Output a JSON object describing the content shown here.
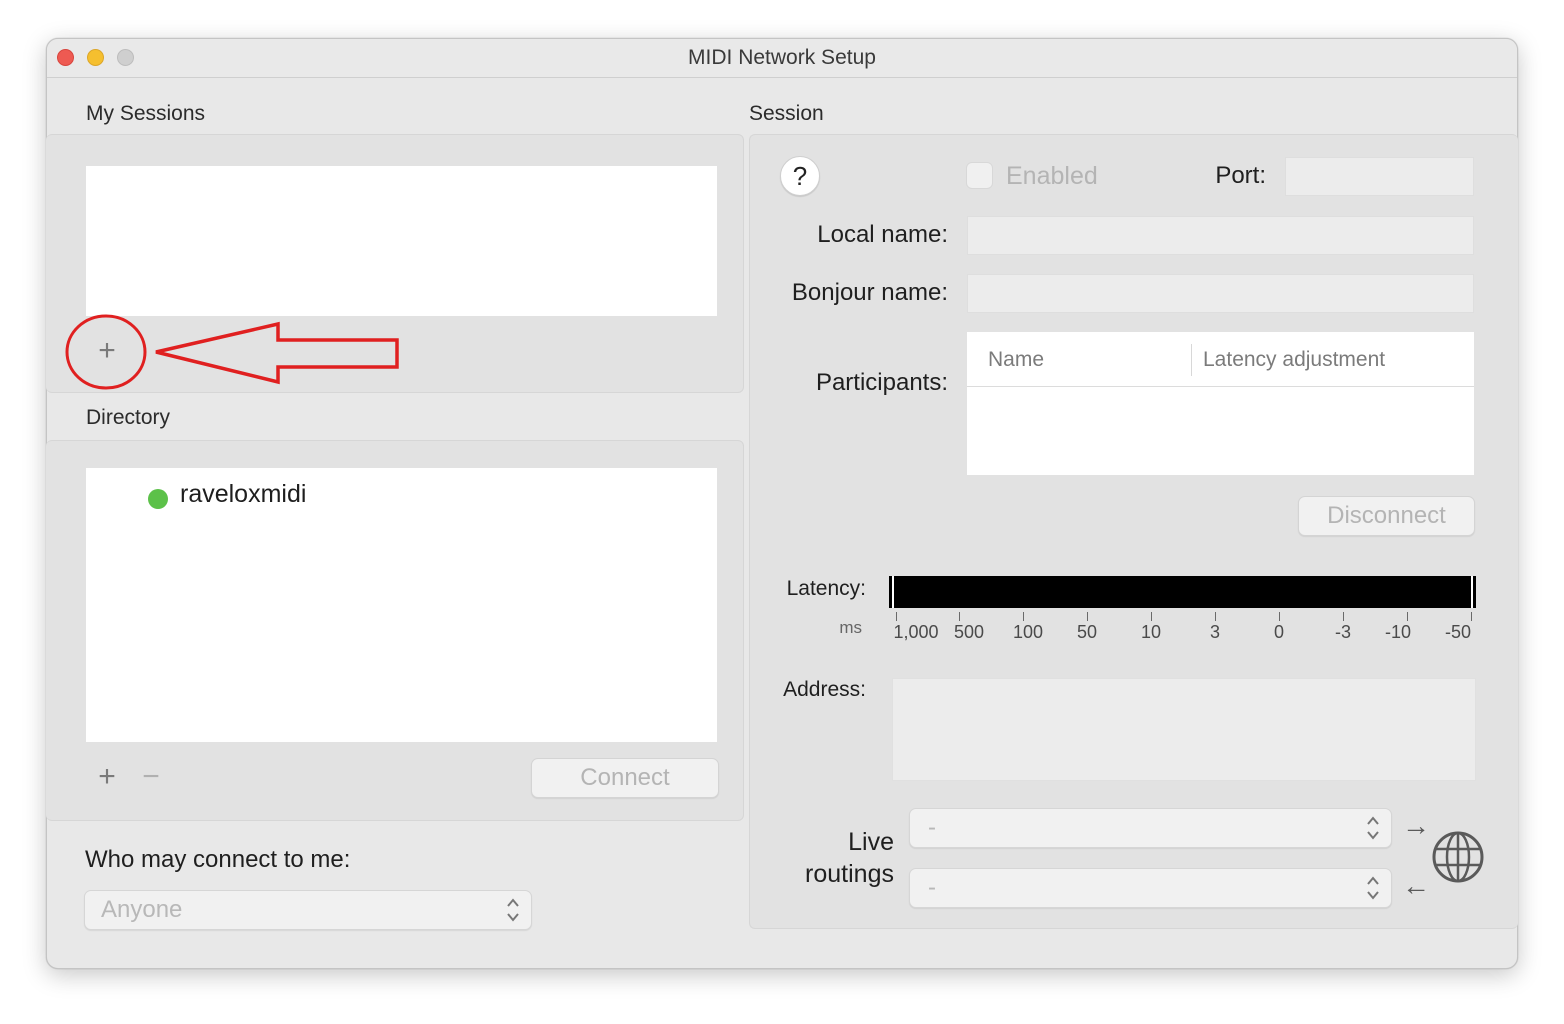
{
  "window": {
    "title": "MIDI Network Setup"
  },
  "my_sessions": {
    "heading": "My Sessions",
    "add_symbol": "+"
  },
  "directory": {
    "heading": "Directory",
    "items": [
      {
        "name": "raveloxmidi",
        "status_color": "#5cc149"
      }
    ],
    "add_symbol": "+",
    "remove_symbol": "−",
    "connect_label": "Connect"
  },
  "who_may_connect": {
    "label": "Who may connect to me:",
    "selected": "Anyone"
  },
  "session": {
    "heading": "Session",
    "help_symbol": "?",
    "enabled_label": "Enabled",
    "port_label": "Port:",
    "port_value": "",
    "local_name_label": "Local name:",
    "local_name_value": "",
    "bonjour_name_label": "Bonjour name:",
    "bonjour_name_value": "",
    "participants_label": "Participants:",
    "participants_columns": [
      "Name",
      "Latency adjustment"
    ],
    "disconnect_label": "Disconnect",
    "latency_label": "Latency:",
    "latency_unit": "ms",
    "latency_ticks": [
      "1,000",
      "500",
      "100",
      "50",
      "10",
      "3",
      "0",
      "-3",
      "-10",
      "-50"
    ],
    "address_label": "Address:",
    "live_routings_label_line1": "Live",
    "live_routings_label_line2": "routings",
    "routing_out_value": "-",
    "routing_in_value": "-",
    "arrow_out_symbol": "→",
    "arrow_in_symbol": "←"
  },
  "annotation": {
    "color": "#e02020"
  }
}
